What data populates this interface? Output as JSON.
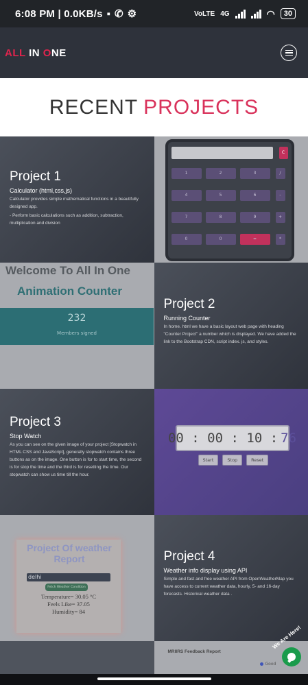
{
  "status_bar": {
    "time": "6:08 PM | 0.0KB/s",
    "network": "4G",
    "volte": "VoLTE",
    "battery": "30"
  },
  "navbar": {
    "logo_part1": "ALL ",
    "logo_part2": "IN",
    "logo_part3": " ",
    "logo_part4": "O",
    "logo_part5": "NE"
  },
  "section_title": {
    "word1": "RECENT",
    "word2": "PROJECTS"
  },
  "projects": [
    {
      "title": "Project 1",
      "subtitle": "Calculator (html,css,js)",
      "desc1": "Calculator provides simple mathematical functions in a beautifully designed app.",
      "desc2": "- Perform basic calculations such as addition, subtraction, multiplication and division"
    },
    {
      "title": "Project 2",
      "subtitle": "Running Counter",
      "desc1": "In home. html we have a basic layout web page with heading \"Counter Project\" a number which is displayed. We have added the link to the Bootstrap CDN, script index. js, and styles."
    },
    {
      "title": "Project 3",
      "subtitle": "Stop Watch",
      "desc1": "As you can see on the given image of your project [Stopwatch in HTML CSS and JavaScript], generally stopwatch contains three buttons as on the image. One button is for to start time, the second is for stop the time and the third is for resetting the time. Our stopwatch can show us time till the hour."
    },
    {
      "title": "Project 4",
      "subtitle": "Weather info display using API",
      "desc1": "Simple and fast and free weather API from OpenWeatherMap you have access to current weather data, hourly, 5- and 16-day forecasts. Historical weather data ."
    }
  ],
  "calculator": {
    "clear": "C",
    "keys": [
      "1",
      "2",
      "3",
      "/",
      "4",
      "5",
      "6",
      "-",
      "7",
      "8",
      "9",
      "+",
      "0",
      "=",
      "*"
    ]
  },
  "counter": {
    "welcome": "Welcome To All In One",
    "heading": "Animation Counter",
    "number": "232",
    "label": "Members signed"
  },
  "stopwatch": {
    "hours": "00",
    "minutes": "00",
    "seconds": "10",
    "ms": "76",
    "start": "Start",
    "stop": "Stop",
    "reset": "Reset"
  },
  "weather": {
    "title": "Project Of weather Report",
    "city": "delhi",
    "button": "Fetch Weather Condition",
    "temperature": "Temperature= 30.05 °C",
    "feels_like": "Feels Like= 37.05",
    "humidity": "Humidity= 84"
  },
  "feedback": {
    "title": "MRIIRS Feedback Report",
    "good": "Good"
  },
  "chat": {
    "label": "We Are Here!"
  },
  "colors": {
    "accent": "#d9325b",
    "navbar": "#2e323b",
    "calc_key": "#5b4f76",
    "stopwatch_bg": "#5e4996",
    "chat": "#1a9b4c"
  }
}
